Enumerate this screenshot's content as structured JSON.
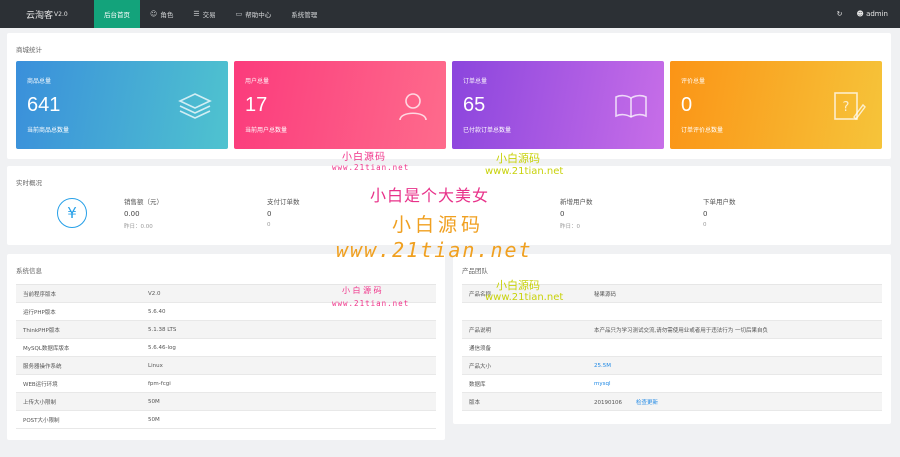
{
  "app": {
    "brand": "云淘客",
    "version": "V2.0",
    "user": "admin",
    "refresh_icon": "refresh-icon",
    "user_icon": "user-icon"
  },
  "nav": [
    {
      "label": "后台首页",
      "icon": "",
      "active": true
    },
    {
      "label": "角色",
      "icon": "user-icon",
      "active": false
    },
    {
      "label": "交易",
      "icon": "layers-icon",
      "active": false
    },
    {
      "label": "帮助中心",
      "icon": "book-icon",
      "active": false
    },
    {
      "label": "系统管理",
      "icon": "",
      "active": false
    }
  ],
  "stats": {
    "title": "商城统计",
    "cards": [
      {
        "label": "商品总量",
        "value": "641",
        "sub": "当前商品总数量",
        "icon": "layers-icon",
        "color_from": "#3a8fdb",
        "color_to": "#4fc3cf"
      },
      {
        "label": "用户总量",
        "value": "17",
        "sub": "当前用户总数量",
        "icon": "user-icon",
        "color_from": "#fb3b7c",
        "color_to": "#fe6b8c"
      },
      {
        "label": "订单总量",
        "value": "65",
        "sub": "已付款订单总数量",
        "icon": "book-icon",
        "color_from": "#8b45dd",
        "color_to": "#c76ee8"
      },
      {
        "label": "评价总量",
        "value": "0",
        "sub": "订单评价总数量",
        "icon": "help-edit-icon",
        "color_from": "#fb9416",
        "color_to": "#f6c43a"
      }
    ]
  },
  "realtime": {
    "title": "实时概况",
    "icon": "yen-icon",
    "items": [
      {
        "label": "销售额（元）",
        "value": "0.00",
        "yesterday": "昨日：0.00"
      },
      {
        "label": "支付订单数",
        "value": "0",
        "yesterday": "0"
      },
      {
        "label": "新增用户数",
        "value": "0",
        "yesterday": "昨日：0"
      },
      {
        "label": "下单用户数",
        "value": "0",
        "yesterday": "0"
      }
    ]
  },
  "sysinfo": {
    "title": "系统信息",
    "rows": [
      {
        "k": "当前程序版本",
        "v": "V2.0"
      },
      {
        "k": "运行PHP版本",
        "v": "5.6.40"
      },
      {
        "k": "ThinkPHP版本",
        "v": "5.1.38 LTS"
      },
      {
        "k": "MySQL数据库版本",
        "v": "5.6.46-log"
      },
      {
        "k": "服务器操作系统",
        "v": "Linux"
      },
      {
        "k": "WEB运行环境",
        "v": "fpm-fcgi"
      },
      {
        "k": "上传大小限制",
        "v": "50M"
      },
      {
        "k": "POST大小限制",
        "v": "50M"
      }
    ]
  },
  "team": {
    "title": "产品团队",
    "rows": [
      {
        "k": "产品名称",
        "v": "秘果源码",
        "link": false,
        "tag": ""
      },
      {
        "k": "",
        "v": "",
        "link": false,
        "tag": ""
      },
      {
        "k": "产品说明",
        "v": "本产品只为学习测试交流,请勿需使用业或者用于违法行为 一切后果自负",
        "link": false,
        "tag": ""
      },
      {
        "k": "通信须备",
        "v": "",
        "link": false,
        "tag": ""
      },
      {
        "k": "产品大小",
        "v": "25.5M",
        "link": true,
        "tag": ""
      },
      {
        "k": "数据库",
        "v": "mysql",
        "link": true,
        "tag": ""
      },
      {
        "k": "版本",
        "v": "20190106",
        "link": false,
        "tag": "检查更新"
      }
    ]
  },
  "watermarks": {
    "w1": "小白源码",
    "w2": "www.21tian.net",
    "w3": "小白源码",
    "w4": "www.21tian.net",
    "w5": "小白是个大美女",
    "w6": "小白源码",
    "w7": "www.21tian.net",
    "w8": "小 白 源 码",
    "w9": "www.21tian.net",
    "w10": "小白源码",
    "w11": "www.21tian.net"
  }
}
